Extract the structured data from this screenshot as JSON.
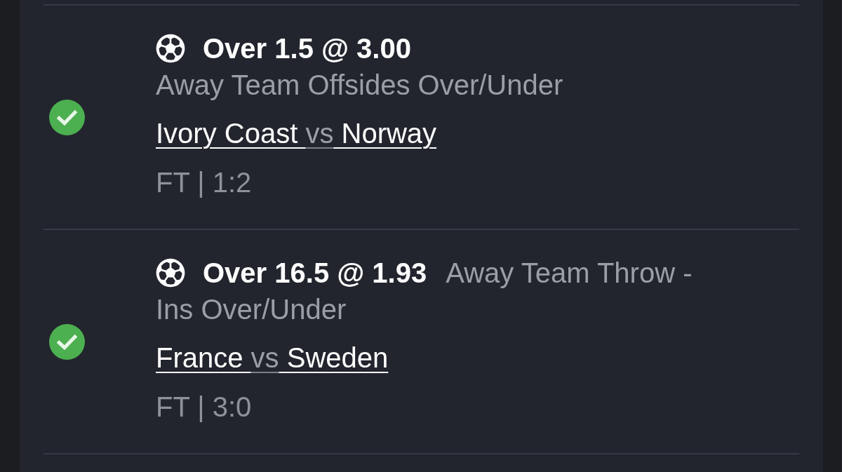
{
  "bets": [
    {
      "won": true,
      "kind": "stacked",
      "title": "Over 1.5 @ 3.00",
      "market_lines": [
        "Away Team Offsides Over/Under"
      ],
      "home": "Ivory Coast",
      "separator": "vs",
      "away": "Norway",
      "result": "FT | 1:2"
    },
    {
      "won": true,
      "kind": "inline",
      "title": "Over 16.5 @ 1.93",
      "market_lines": [
        "Away Team Throw -",
        "Ins Over/Under"
      ],
      "home": "France",
      "separator": "vs",
      "away": "Sweden",
      "result": "FT | 3:0"
    }
  ]
}
